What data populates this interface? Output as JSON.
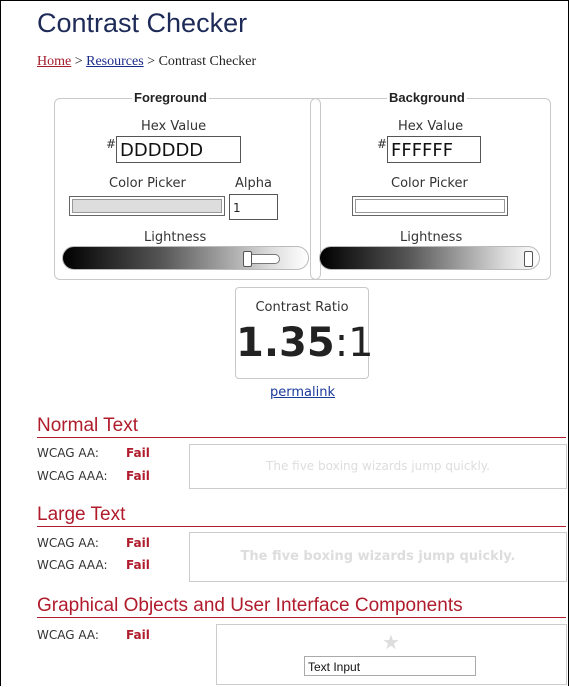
{
  "page": {
    "title": "Contrast Checker",
    "breadcrumb": {
      "home": "Home",
      "sep1": ">",
      "resources": "Resources",
      "sep2": ">",
      "current": "Contrast Checker"
    }
  },
  "foreground": {
    "legend": "Foreground",
    "hex_label": "Hex Value",
    "hash": "#",
    "hex_value": "DDDDDD",
    "picker_label": "Color Picker",
    "alpha_label": "Alpha",
    "alpha_value": "1",
    "lightness_label": "Lightness",
    "color": "#dddddd",
    "lightness_level": 0.87
  },
  "background": {
    "legend": "Background",
    "hex_label": "Hex Value",
    "hash": "#",
    "hex_value": "FFFFFF",
    "picker_label": "Color Picker",
    "lightness_label": "Lightness",
    "color": "#ffffff",
    "lightness_level": 1.0
  },
  "ratio": {
    "label": "Contrast Ratio",
    "value": "1.35",
    "suffix": ":1",
    "permalink": "permalink"
  },
  "normal_text": {
    "heading": "Normal Text",
    "aa_label": "WCAG AA:",
    "aa_result": "Fail",
    "aaa_label": "WCAG AAA:",
    "aaa_result": "Fail",
    "sample": "The five boxing wizards jump quickly."
  },
  "large_text": {
    "heading": "Large Text",
    "aa_label": "WCAG AA:",
    "aa_result": "Fail",
    "aaa_label": "WCAG AAA:",
    "aaa_result": "Fail",
    "sample": "The five boxing wizards jump quickly."
  },
  "graphical": {
    "heading": "Graphical Objects and User Interface Components",
    "aa_label": "WCAG AA:",
    "aa_result": "Fail",
    "star_icon": "star-icon",
    "text_input": "Text Input"
  },
  "colors": {
    "brand_red": "#b01c2c",
    "title_navy": "#1e2a57",
    "link_blue": "#1a3a9a"
  }
}
